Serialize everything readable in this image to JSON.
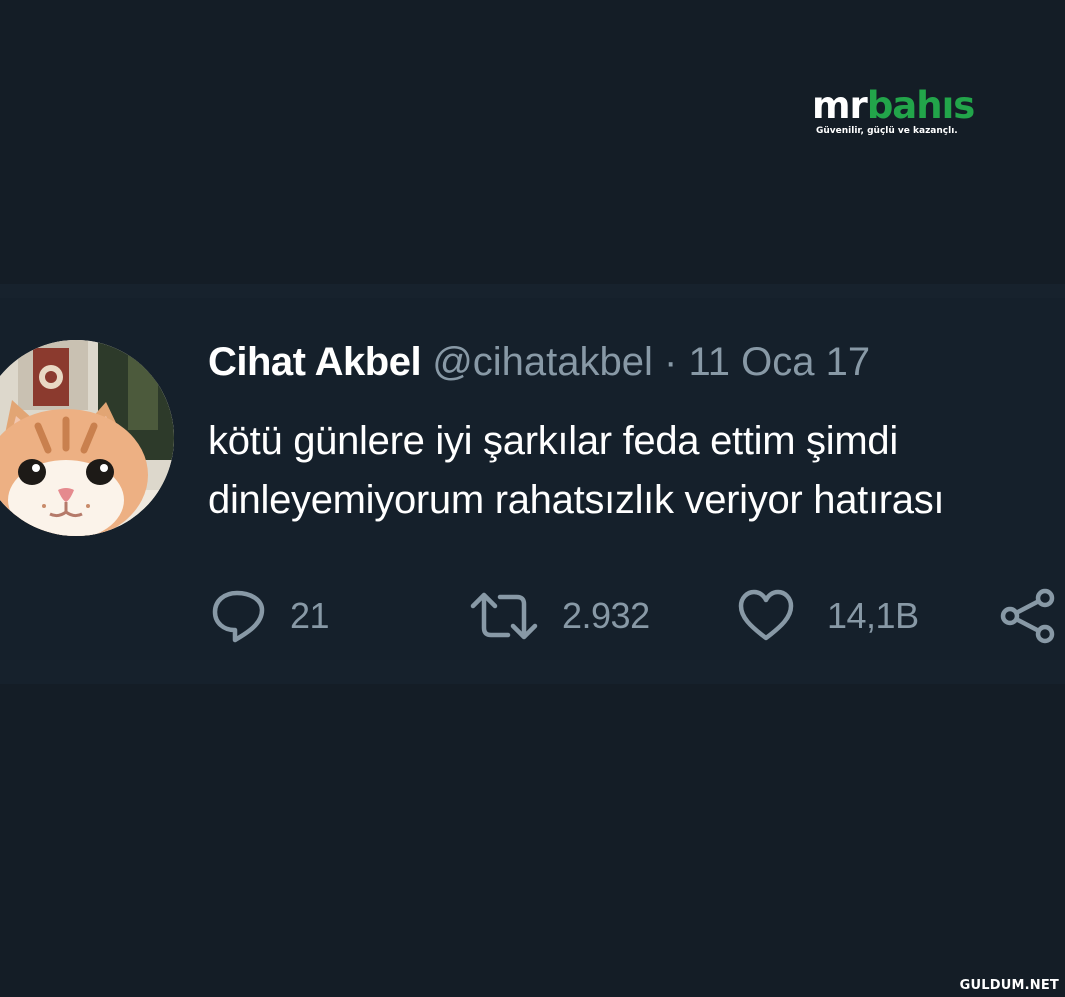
{
  "watermark": {
    "brand_mr": "mr",
    "brand_bahis": "bahıs",
    "tagline": "Güvenilir, güçlü ve kazançlı.",
    "site": "GULDUM.NET"
  },
  "tweet": {
    "author_name": "Cihat Akbel",
    "author_handle": "@cihatakbel",
    "separator": "·",
    "date": "11 Oca 17",
    "text": "kötü günlere iyi şarkılar feda ettim şimdi dinleyemiyorum rahatsızlık veriyor hatırası",
    "actions": {
      "reply_count": "21",
      "retweet_count": "2.932",
      "like_count": "14,1B"
    }
  },
  "colors": {
    "background": "#141d26",
    "text_primary": "#ffffff",
    "text_secondary": "#8899a6",
    "brand_accent": "#22a54a"
  },
  "icons": [
    "reply-icon",
    "retweet-icon",
    "like-icon",
    "share-icon"
  ]
}
